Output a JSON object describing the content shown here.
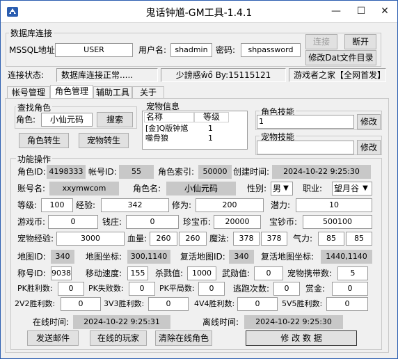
{
  "window": {
    "title": "鬼话钟馗-GM工具-1.4.1",
    "minimize_glyph": "—",
    "maximize_glyph": "☐",
    "close_glyph": "✕",
    "accent": "#2a5db0"
  },
  "db": {
    "group_label": "数据库连接",
    "addr_label": "MSSQL地址:",
    "addr_value": "USER",
    "user_label": "用户名:",
    "user_value": "shadmin",
    "pwd_label": "密码:",
    "pwd_value": "shpassword",
    "connect_label": "连接",
    "disconnect_label": "断开",
    "edit_dat_label": "修改Dat文件目录"
  },
  "status": {
    "label": "连接状态:",
    "value": "数据库连接正常.....",
    "author": "少謗惑ŵő By:15115121",
    "promo": "游戏者之家【全网首发】"
  },
  "tabs": [
    "帐号管理",
    "角色管理",
    "辅助工具",
    "关于"
  ],
  "search": {
    "group_label": "查找角色",
    "role_label": "角色:",
    "role_value": "小仙元码",
    "search_label": "搜索",
    "reincarnate_label": "角色转生",
    "pet_reincarnate_label": "宠物转生"
  },
  "pets": {
    "group_label": "宠物信息",
    "col_name": "名称",
    "col_level": "等级",
    "rows": [
      {
        "name": "[金]Q版钟馗",
        "level": "1"
      },
      {
        "name": "噬骨狼",
        "level": "1"
      }
    ]
  },
  "role_skill": {
    "label": "角色技能",
    "value": "1",
    "edit_label": "修改"
  },
  "pet_skill": {
    "label": "宠物技能",
    "value": "",
    "edit_label": "修改"
  },
  "func": {
    "group_label": "功能操作",
    "role_id_label": "角色ID:",
    "role_id": "4198333",
    "account_id_label": "帐号ID:",
    "account_id": "55",
    "role_index_label": "角色索引:",
    "role_index": "50000",
    "create_time_label": "创建时间:",
    "create_time": "2024-10-22 9:25:30",
    "account_name_label": "账号名:",
    "account_name": "xxymwcom",
    "role_name_label": "角色名:",
    "role_name": "小仙元码",
    "gender_label": "性别:",
    "gender": "男",
    "job_label": "职业:",
    "job": "望月谷",
    "level_label": "等级:",
    "level": "100",
    "exp_label": "经验:",
    "exp": "342",
    "cultivation_label": "修为:",
    "cultivation": "200",
    "potential_label": "潜力:",
    "potential": "10",
    "game_coin_label": "游戏币:",
    "game_coin": "0",
    "bank_label": "钱庄:",
    "bank": "0",
    "treasure_coin_label": "珍宝币:",
    "treasure_coin": "20000",
    "bao_chao_label": "宝钞币:",
    "bao_chao": "500100",
    "pet_exp_label": "宠物经验:",
    "pet_exp": "3000",
    "hp_label": "血量:",
    "hp": "260",
    "hp_max": "260",
    "mp_label": "魔法:",
    "mp": "378",
    "mp_max": "378",
    "qi_label": "气力:",
    "qi": "85",
    "qi_max": "85",
    "map_id_label": "地图ID:",
    "map_id": "340",
    "map_coord_label": "地图坐标:",
    "map_coord": "300,1140",
    "revive_map_id_label": "复活地图ID:",
    "revive_map_id": "340",
    "revive_coord_label": "复活地图坐标:",
    "revive_coord": "1440,1140",
    "title_id_label": "称号ID:",
    "title_id": "9038",
    "move_speed_label": "移动速度:",
    "move_speed": "155",
    "kill_label": "杀戮值:",
    "kill": "1000",
    "wuxun_label": "武勋值:",
    "wuxun": "0",
    "pet_carry_label": "宠物携带数:",
    "pet_carry": "5",
    "pk_win_label": "PK胜利数:",
    "pk_win": "0",
    "pk_lose_label": "PK失败数:",
    "pk_lose": "0",
    "pk_draw_label": "PK平局数:",
    "pk_draw": "0",
    "escape_label": "逃跑次数:",
    "escape": "0",
    "bounty_label": "赏金:",
    "bounty": "0",
    "v2_label": "2V2胜利数:",
    "v2": "0",
    "v3_label": "3V3胜利数:",
    "v3": "0",
    "v4_label": "4V4胜利数:",
    "v4": "0",
    "v5_label": "5V5胜利数:",
    "v5": "0",
    "online_time_label": "在线时间:",
    "online_time": "2024-10-22 9:25:31",
    "offline_time_label": "离线时间:",
    "offline_time": "2024-10-22 9:25:30"
  },
  "actions": {
    "send_mail": "发送邮件",
    "online_players": "在线的玩家",
    "clear_online": "清除在线角色",
    "modify_data": "修 改 数 据"
  }
}
